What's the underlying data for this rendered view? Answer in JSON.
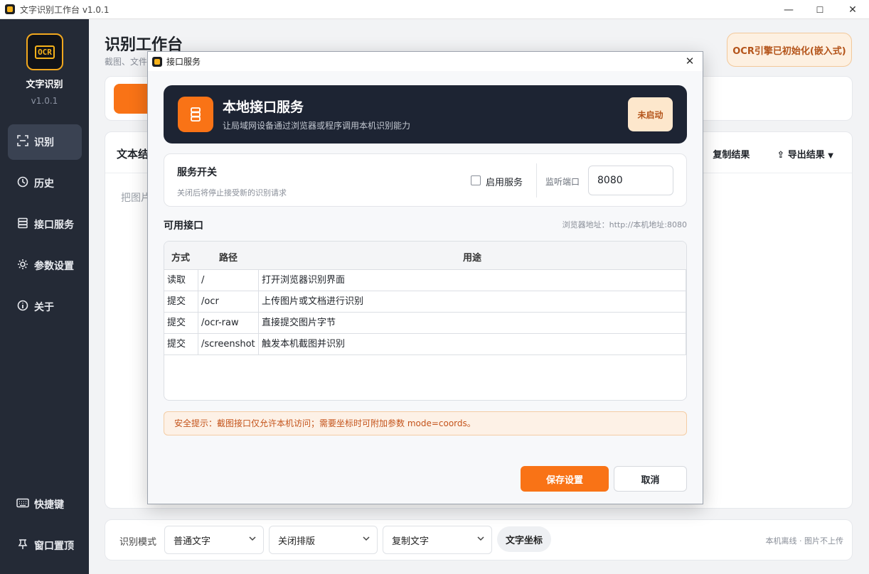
{
  "window": {
    "title": "文字识别工作台 v1.0.1",
    "minimize": "—",
    "maximize": "☐",
    "close": "✕"
  },
  "sidebar": {
    "app_name": "文字识别",
    "version": "v1.0.1",
    "logo_text": "OCR",
    "items": [
      {
        "label": "识别",
        "icon": "scan-icon"
      },
      {
        "label": "历史",
        "icon": "clock-icon"
      },
      {
        "label": "接口服务",
        "icon": "server-icon"
      },
      {
        "label": "参数设置",
        "icon": "gear-icon"
      },
      {
        "label": "关于",
        "icon": "info-icon"
      }
    ],
    "bottom_items": [
      {
        "label": "快捷键",
        "icon": "keyboard-icon"
      },
      {
        "label": "窗口置顶",
        "icon": "pin-icon"
      }
    ]
  },
  "main": {
    "title": "识别工作台",
    "subtitle": "截图、文件",
    "ocr_status": "OCR引擎已初始化(嵌入式)",
    "content": {
      "title": "文本结",
      "copy_result": "复制结果",
      "export_result": "导出结果",
      "placeholder": "把图片"
    }
  },
  "bottombar": {
    "mode_label": "识别模式",
    "select_mode": "普通文字",
    "select_layout": "关闭排版",
    "select_copy": "复制文字",
    "coords_chip": "文字坐标",
    "status": "本机离线 · 图片不上传"
  },
  "dialog": {
    "title": "接口服务",
    "hero": {
      "title": "本地接口服务",
      "subtitle": "让局域网设备通过浏览器或程序调用本机识别能力",
      "status": "未启动"
    },
    "service_switch": {
      "title": "服务开关",
      "description": "关闭后将停止接受新的识别请求",
      "enable_label": "启用服务",
      "enabled": false,
      "port_label": "监听端口",
      "port_value": "8080"
    },
    "api_section": {
      "title": "可用接口",
      "browser_hint": "浏览器地址：http://本机地址:8080",
      "columns": [
        "方式",
        "路径",
        "用途"
      ],
      "rows": [
        {
          "method": "读取",
          "path": "/",
          "purpose": "打开浏览器识别界面"
        },
        {
          "method": "提交",
          "path": "/ocr",
          "purpose": "上传图片或文档进行识别"
        },
        {
          "method": "提交",
          "path": "/ocr-raw",
          "purpose": "直接提交图片字节"
        },
        {
          "method": "提交",
          "path": "/screenshot",
          "purpose": "触发本机截图并识别"
        }
      ]
    },
    "notice": "安全提示：截图接口仅允许本机访问；需要坐标时可附加参数 mode=coords。",
    "save_button": "保存设置",
    "cancel_button": "取消"
  },
  "colors": {
    "accent": "#f97316",
    "sidebar_bg": "#242a36",
    "hero_bg": "#1d2433"
  }
}
